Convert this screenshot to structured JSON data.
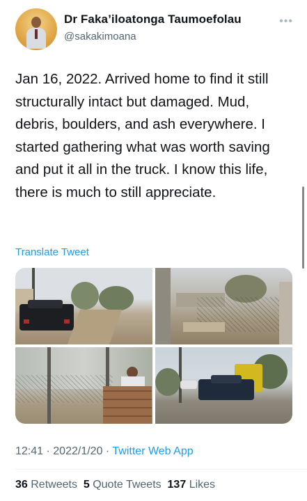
{
  "author": {
    "name": "Dr Faka’iloatonga Taumoefolau",
    "handle": "@sakakimoana"
  },
  "more_icon": "more-horizontal-icon",
  "tweet": {
    "text": "Jan 16, 2022. Arrived home to find it still structurally intact but damaged. Mud, debris, boulders, and ash everywhere. I started gathering what was worth saving and put it all in the truck. I know this life, there is much to still appreciate.",
    "translate_label": "Translate Tweet"
  },
  "meta": {
    "time": "12:41",
    "separator": "·",
    "date": "2022/1/20",
    "app": "Twitter Web App"
  },
  "stats": {
    "retweets_count": "36",
    "retweets_label": "Retweets",
    "quotes_count": "5",
    "quotes_label": "Quote Tweets",
    "likes_count": "137",
    "likes_label": "Likes"
  },
  "colors": {
    "link": "#1d9bf0",
    "secondary": "#536471",
    "text": "#0f1419"
  }
}
